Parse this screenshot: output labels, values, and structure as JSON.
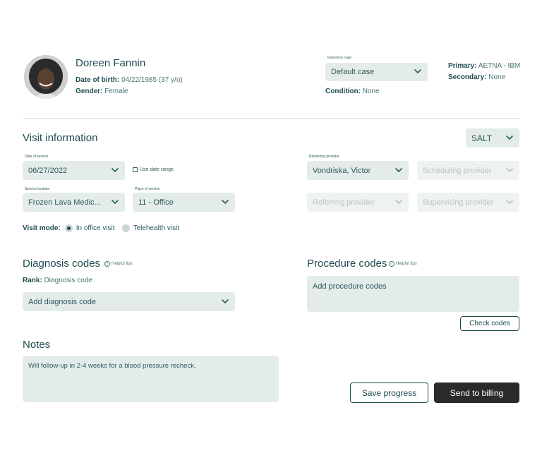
{
  "patient": {
    "name": "Doreen Fannin",
    "dob_label": "Date of birth:",
    "dob_value": "04/22/1985 (37 y/o)",
    "gender_label": "Gender:",
    "gender_value": "Female"
  },
  "insurance": {
    "case_label": "Insurance case",
    "case_value": "Default case",
    "condition_label": "Condition:",
    "condition_value": "None",
    "primary_label": "Primary:",
    "primary_value": "AETNA - IBM",
    "secondary_label": "Secondary:",
    "secondary_value": "None"
  },
  "visit": {
    "title": "Visit information",
    "location_code": "SALT",
    "date_label": "Date of service",
    "date_value": "06/27/2022",
    "date_range_label": "Use date range",
    "rendering_label": "Rendering provider",
    "rendering_value": "Vondriska, Victor",
    "scheduling_placeholder": "Scheduling provider",
    "service_location_label": "Service location",
    "service_location_value": "Frozen Lava Medic...",
    "place_label": "Place of service",
    "place_value": "11 - Office",
    "referring_placeholder": "Referring provider",
    "supervising_placeholder": "Supervising provider",
    "mode_label": "Visit mode:",
    "mode_options": [
      "In office visit",
      "Telehealth visit"
    ],
    "mode_selected": "In office visit"
  },
  "diagnosis": {
    "title": "Diagnosis codes",
    "tips": "Helpful tips",
    "rank_label": "Rank:",
    "rank_value": "Diagnosis code",
    "add_placeholder": "Add diagnosis code"
  },
  "procedure": {
    "title": "Procedure codes",
    "tips": "Helpful tips",
    "add_placeholder": "Add procedure codes",
    "check_button": "Check codes"
  },
  "notes": {
    "title": "Notes",
    "text": "Will follow-up in 2-4 weeks for a blood pressure recheck."
  },
  "actions": {
    "save": "Save progress",
    "send": "Send to billing"
  },
  "colors": {
    "accent": "#1f4d4f",
    "field_bg": "#e4ecea",
    "primary_button": "#2b2b2b"
  },
  "icons": [
    "avatar-photo",
    "chevron-down-icon",
    "info-icon",
    "checkbox-icon",
    "radio-icon"
  ]
}
